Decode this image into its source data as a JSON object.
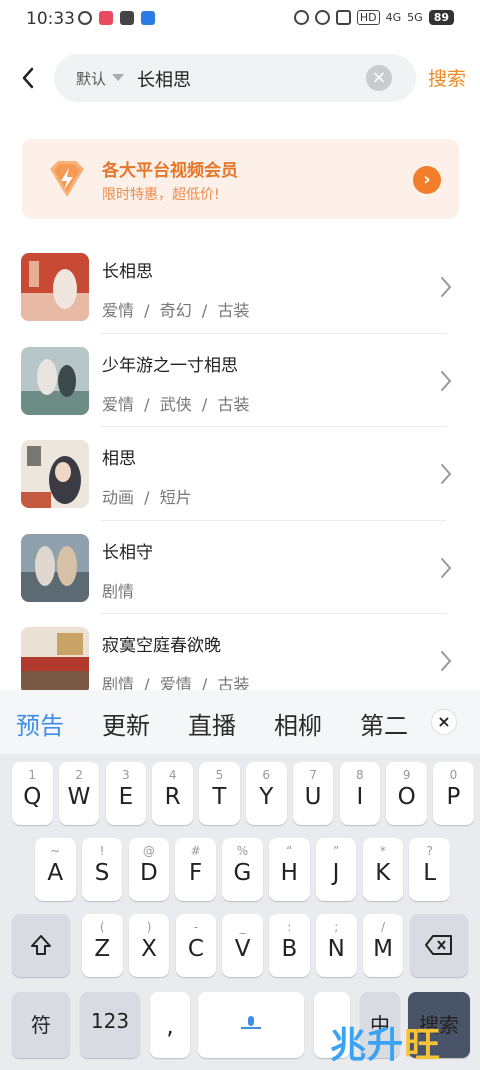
{
  "status_bar": {
    "time": "10:33",
    "network_hd": "HD",
    "network_4g": "4G",
    "network_5g": "5G",
    "battery": "89"
  },
  "search": {
    "sort_label": "默认",
    "query": "长相思",
    "submit_label": "搜索"
  },
  "vip_banner": {
    "title": "各大平台视频会员",
    "subtitle": "限时特惠，超低价!"
  },
  "results": [
    {
      "title": "长相思",
      "tags": "爱情  /  奇幻  /  古装"
    },
    {
      "title": "少年游之一寸相思",
      "tags": "爱情  /  武侠  /  古装"
    },
    {
      "title": "相思",
      "tags": "动画  /  短片"
    },
    {
      "title": "长相守",
      "tags": "剧情"
    },
    {
      "title": "寂寞空庭春欲晚",
      "tags": "剧情  /  爱情  /  古装"
    }
  ],
  "keyboard": {
    "candidates": [
      "预告",
      "更新",
      "直播",
      "相柳",
      "第二"
    ],
    "row1": [
      {
        "main": "Q",
        "sub": "1"
      },
      {
        "main": "W",
        "sub": "2"
      },
      {
        "main": "E",
        "sub": "3"
      },
      {
        "main": "R",
        "sub": "4"
      },
      {
        "main": "T",
        "sub": "5"
      },
      {
        "main": "Y",
        "sub": "6"
      },
      {
        "main": "U",
        "sub": "7"
      },
      {
        "main": "I",
        "sub": "8"
      },
      {
        "main": "O",
        "sub": "9"
      },
      {
        "main": "P",
        "sub": "0"
      }
    ],
    "row2": [
      {
        "main": "A",
        "sub": "~"
      },
      {
        "main": "S",
        "sub": "!"
      },
      {
        "main": "D",
        "sub": "@"
      },
      {
        "main": "F",
        "sub": "#"
      },
      {
        "main": "G",
        "sub": "%"
      },
      {
        "main": "H",
        "sub": "“"
      },
      {
        "main": "J",
        "sub": "”"
      },
      {
        "main": "K",
        "sub": "*"
      },
      {
        "main": "L",
        "sub": "?"
      }
    ],
    "row3": [
      {
        "main": "Z",
        "sub": "("
      },
      {
        "main": "X",
        "sub": ")"
      },
      {
        "main": "C",
        "sub": "-"
      },
      {
        "main": "V",
        "sub": "_"
      },
      {
        "main": "B",
        "sub": ":"
      },
      {
        "main": "N",
        "sub": ";"
      },
      {
        "main": "M",
        "sub": "/"
      }
    ],
    "symbol_key": "符",
    "number_key": "123",
    "comma_key": ",",
    "lang_key": "中",
    "search_key": "搜索"
  },
  "watermark": {
    "part1": "兆升",
    "part2": "旺"
  },
  "colors": {
    "accent": "#f08a24",
    "candidate_active": "#3d8fe6"
  }
}
